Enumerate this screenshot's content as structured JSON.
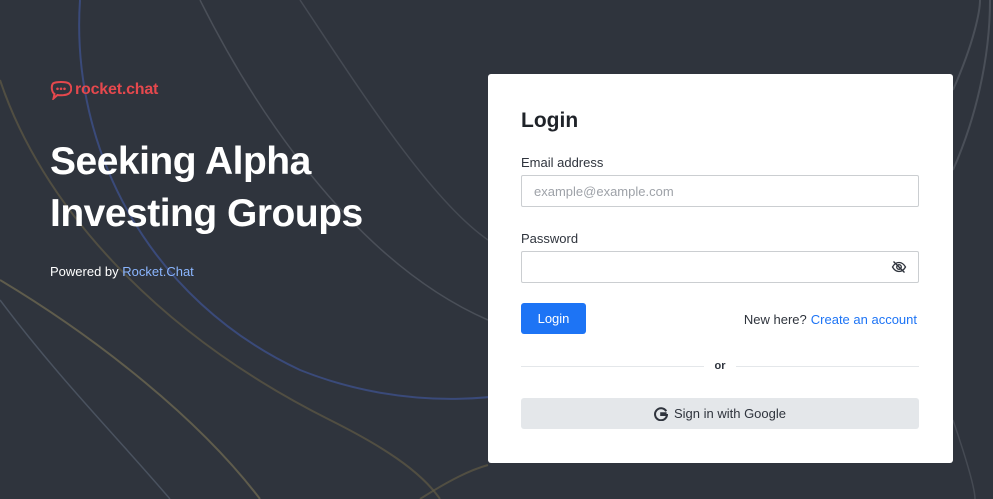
{
  "brand": {
    "name": "rocket.chat",
    "color": "#e5484d"
  },
  "hero": {
    "title_line1": "Seeking Alpha",
    "title_line2": "Investing Groups"
  },
  "powered_by": {
    "prefix": "Powered by ",
    "link": "Rocket.Chat"
  },
  "login": {
    "title": "Login",
    "email_label": "Email address",
    "email_placeholder": "example@example.com",
    "email_value": "",
    "password_label": "Password",
    "password_value": "",
    "password_toggle_icon": "eye-slash-icon",
    "submit_label": "Login",
    "new_here": "New here?",
    "create_account": "Create an account",
    "divider_text": "or",
    "google_label": "Sign in with Google",
    "google_icon": "google-g-icon"
  },
  "colors": {
    "background": "#2f343d",
    "accent": "#1d74f5",
    "link_on_dark": "#8bb6ff",
    "secondary_button": "#e4e7ea"
  }
}
